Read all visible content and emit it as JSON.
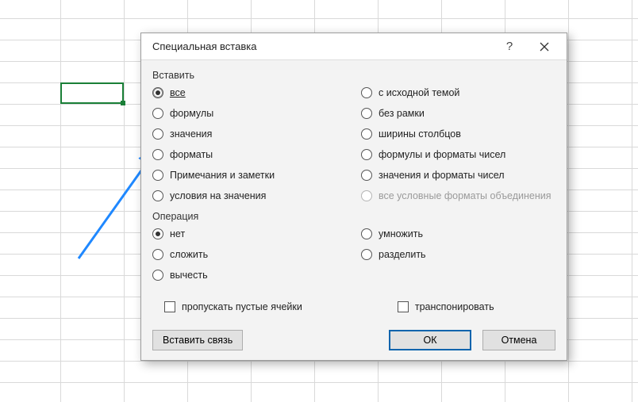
{
  "dialog": {
    "title": "Специальная вставка",
    "help_tooltip": "?",
    "paste_label": "Вставить",
    "paste_options_left": [
      "все",
      "формулы",
      "значения",
      "форматы",
      "Примечания и заметки",
      "условия на значения"
    ],
    "paste_options_right": [
      "с исходной темой",
      "без рамки",
      "ширины столбцов",
      "формулы и форматы чисел",
      "значения и форматы чисел",
      "все условные форматы объединения"
    ],
    "operation_label": "Операция",
    "operation_left": [
      "нет",
      "сложить",
      "вычесть"
    ],
    "operation_right": [
      "умножить",
      "разделить"
    ],
    "skip_blanks": "пропускать пустые ячейки",
    "transpose": "транспонировать",
    "paste_link": "Вставить связь",
    "ok": "ОК",
    "cancel": "Отмена"
  }
}
